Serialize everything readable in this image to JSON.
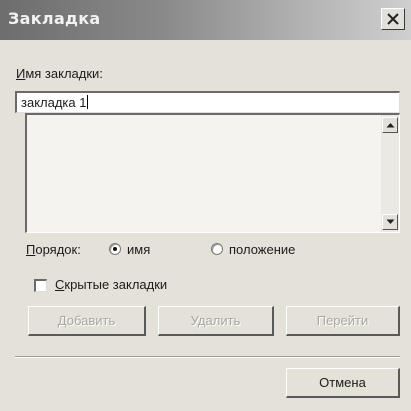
{
  "dialog": {
    "title": "Закладка",
    "close_icon": "close-icon"
  },
  "bookmark_name": {
    "label": "Имя закладки:",
    "value": "закладка 1"
  },
  "bookmarks_list": {
    "items": [],
    "scroll_up_icon": "arrow-up-icon",
    "scroll_down_icon": "arrow-down-icon"
  },
  "sort_order": {
    "label": "Порядок:",
    "options": [
      {
        "label": "имя",
        "selected": true
      },
      {
        "label": "положение",
        "selected": false
      }
    ]
  },
  "hidden_bookmarks": {
    "label": "Скрытые закладки",
    "checked": false
  },
  "actions": {
    "add": "Добавить",
    "delete": "Удалить",
    "goto": "Перейти"
  },
  "cancel": "Отмена"
}
